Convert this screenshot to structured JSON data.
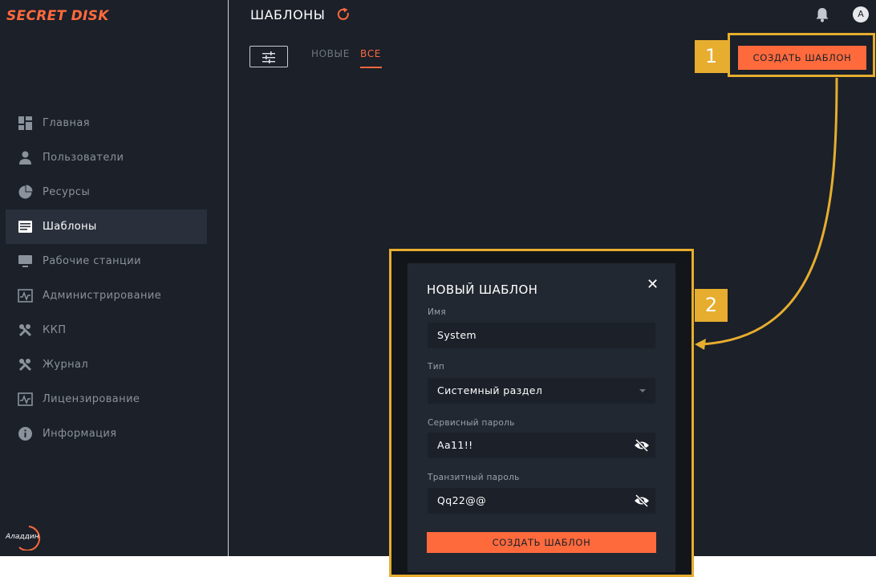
{
  "brand": {
    "logo_text": "SECRET DISK",
    "vendor_logo_text": "Аладдин",
    "accent": "#ff6a3d",
    "annotation_color": "#e6ad2f"
  },
  "sidebar": {
    "items": [
      {
        "label": "Главная",
        "icon": "dashboard-icon",
        "active": false
      },
      {
        "label": "Пользователи",
        "icon": "person-icon",
        "active": false
      },
      {
        "label": "Ресурсы",
        "icon": "pie-chart-icon",
        "active": false
      },
      {
        "label": "Шаблоны",
        "icon": "template-icon",
        "active": true
      },
      {
        "label": "Рабочие станции",
        "icon": "monitor-icon",
        "active": false
      },
      {
        "label": "Администрирование",
        "icon": "monitoring-icon",
        "active": false
      },
      {
        "label": "ККП",
        "icon": "tools-icon",
        "active": false
      },
      {
        "label": "Журнал",
        "icon": "tools-icon",
        "active": false
      },
      {
        "label": "Лицензирование",
        "icon": "monitoring-icon",
        "active": false
      },
      {
        "label": "Информация",
        "icon": "info-icon",
        "active": false
      }
    ]
  },
  "header": {
    "title": "ШАБЛОНЫ",
    "refresh_icon": "refresh-icon",
    "notification_icon": "bell-icon",
    "avatar_letter": "A"
  },
  "toolbar": {
    "filter_icon": "filter-sliders-icon",
    "tabs": [
      {
        "label": "НОВЫЕ",
        "active": false
      },
      {
        "label": "ВСЕ",
        "active": true
      }
    ],
    "create_label": "СОЗДАТЬ ШАБЛОН"
  },
  "annotations": {
    "step1": "1",
    "step2": "2"
  },
  "dialog": {
    "title": "НОВЫЙ ШАБЛОН",
    "close_icon": "close-icon",
    "fields": {
      "name": {
        "label": "Имя",
        "value": "System"
      },
      "type": {
        "label": "Тип",
        "value": "Системный раздел"
      },
      "service_password": {
        "label": "Сервисный пароль",
        "value": "Aa11!!",
        "icon": "eye-off-icon"
      },
      "transit_password": {
        "label": "Транзитный пароль",
        "value": "Qq22@@",
        "icon": "eye-off-icon"
      }
    },
    "submit_label": "СОЗДАТЬ ШАБЛОН"
  }
}
